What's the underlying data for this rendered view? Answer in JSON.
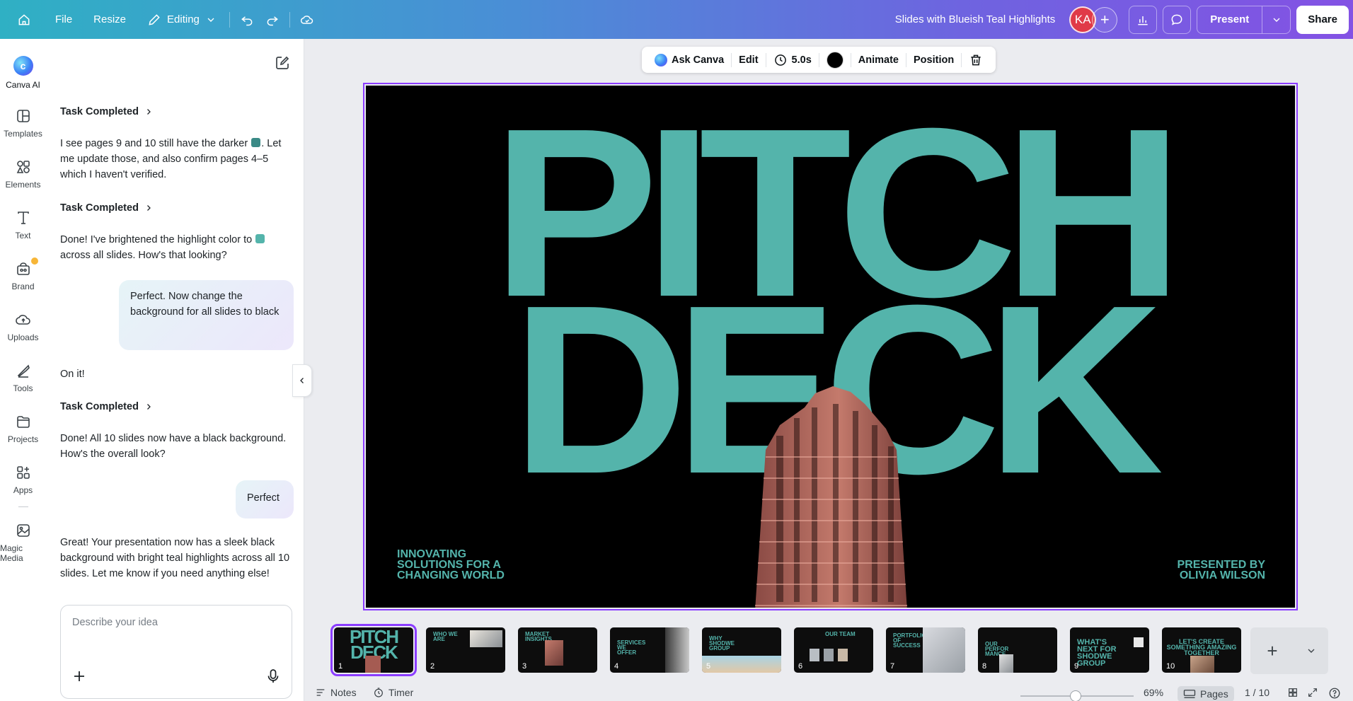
{
  "topbar": {
    "file_label": "File",
    "resize_label": "Resize",
    "editing_label": "Editing",
    "doc_title": "Slides with Blueish Teal Highlights",
    "avatar_initials": "KA",
    "present_label": "Present",
    "share_label": "Share"
  },
  "rail": {
    "items": [
      {
        "label": "Canva AI",
        "icon": "canva-ai-icon"
      },
      {
        "label": "Templates",
        "icon": "templates-icon"
      },
      {
        "label": "Elements",
        "icon": "elements-icon"
      },
      {
        "label": "Text",
        "icon": "text-icon"
      },
      {
        "label": "Brand",
        "icon": "brand-icon"
      },
      {
        "label": "Uploads",
        "icon": "uploads-icon"
      },
      {
        "label": "Tools",
        "icon": "tools-icon"
      },
      {
        "label": "Projects",
        "icon": "projects-icon"
      },
      {
        "label": "Apps",
        "icon": "apps-icon"
      },
      {
        "label": "Magic Media",
        "icon": "magic-media-icon"
      }
    ]
  },
  "chat": {
    "task_completed_label": "Task Completed",
    "msg1_part1": "I see pages 9 and 10 still have the darker",
    "msg1_part2": ". Let me update those, and also confirm pages 4–5 which I haven't verified.",
    "msg2_part1": "Done! I've brightened the highlight color to",
    "msg2_part2": "across all slides. How's that looking?",
    "user_msg1": "Perfect. Now change the background for all slides to black",
    "msg3": "On it!",
    "msg4": "Done! All 10 slides now have a black background. How's the overall look?",
    "user_msg2": "Perfect",
    "msg5": "Great! Your presentation now has a sleek black background with bright teal highlights across all 10 slides. Let me know if you need anything else!",
    "input_placeholder": "Describe your idea",
    "darker_teal": "#3a8a86",
    "bright_teal": "#54b4ab"
  },
  "context_toolbar": {
    "ask_canva": "Ask Canva",
    "edit": "Edit",
    "duration": "5.0s",
    "color": "#000000",
    "animate": "Animate",
    "position": "Position"
  },
  "slide": {
    "line1": "PITCH",
    "line2": "DECK",
    "tagline": "INNOVATING SOLUTIONS FOR A CHANGING WORLD",
    "presented_by": "PRESENTED BY OLIVIA WILSON",
    "background": "#000000",
    "highlight": "#54b4ab"
  },
  "thumbnails": [
    {
      "num": "1",
      "title": "PITCH DECK"
    },
    {
      "num": "2",
      "title": "WHO WE ARE"
    },
    {
      "num": "3",
      "title": "MARKET INSIGHTS"
    },
    {
      "num": "4",
      "title": "SERVICES WE OFFER"
    },
    {
      "num": "5",
      "title": "WHY SHODWE GROUP"
    },
    {
      "num": "6",
      "title": "OUR TEAM"
    },
    {
      "num": "7",
      "title": "PORTFOLIO OF SUCCESS"
    },
    {
      "num": "8",
      "title": "OUR PERFOR MANCE"
    },
    {
      "num": "9",
      "title": "WHAT'S NEXT FOR SHODWE GROUP"
    },
    {
      "num": "10",
      "title": "LET'S CREATE SOMETHING AMAZING TOGETHER"
    }
  ],
  "bottombar": {
    "notes_label": "Notes",
    "timer_label": "Timer",
    "zoom": "69%",
    "pages_label": "Pages",
    "page_counter": "1 / 10"
  }
}
